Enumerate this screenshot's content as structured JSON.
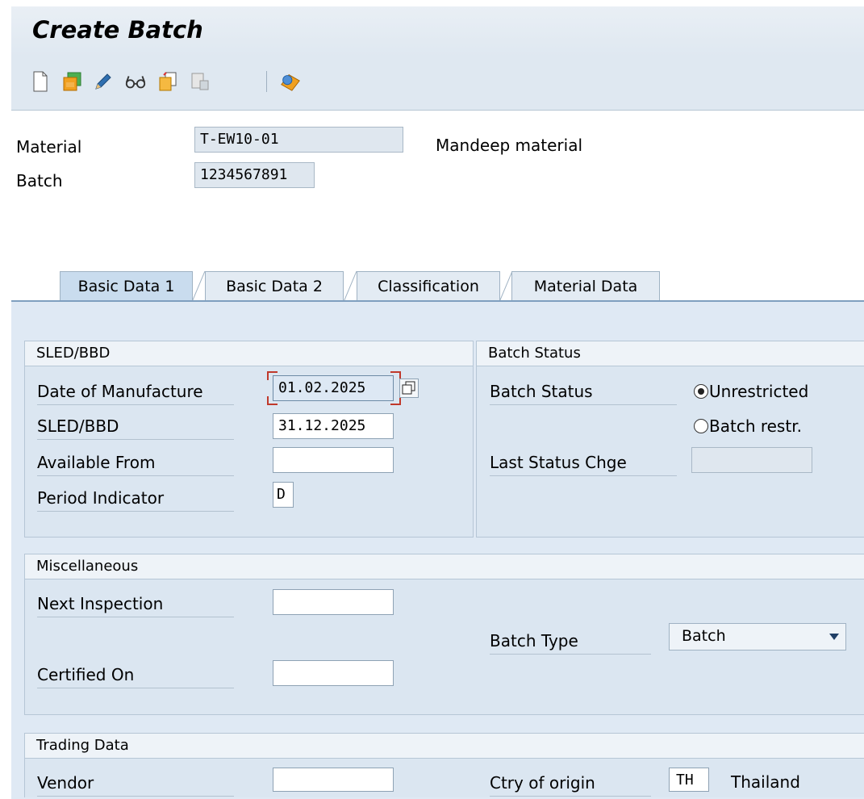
{
  "title": "Create Batch",
  "toolbar": {
    "icons": [
      "new-document-icon",
      "save-icon",
      "edit-pencil-icon",
      "display-glasses-icon",
      "copy-icon",
      "delete-icon",
      "where-used-icon"
    ]
  },
  "header": {
    "material_label": "Material",
    "material_value": "T-EW10-01",
    "material_desc": "Mandeep material",
    "batch_label": "Batch",
    "batch_value": "1234567891"
  },
  "tabs": [
    {
      "label": "Basic Data 1",
      "active": true
    },
    {
      "label": "Basic Data 2",
      "active": false
    },
    {
      "label": "Classification",
      "active": false
    },
    {
      "label": "Material Data",
      "active": false
    }
  ],
  "sled": {
    "title": "SLED/BBD",
    "date_of_manufacture_label": "Date of Manufacture",
    "date_of_manufacture_value": "01.02.2025",
    "sled_label": "SLED/BBD",
    "sled_value": "31.12.2025",
    "available_from_label": "Available From",
    "available_from_value": "",
    "period_indicator_label": "Period Indicator",
    "period_indicator_value": "D"
  },
  "batch_status": {
    "title": "Batch Status",
    "label": "Batch Status",
    "options": [
      {
        "label": "Unrestricted",
        "selected": true
      },
      {
        "label": "Batch restr.",
        "selected": false
      }
    ],
    "last_status_change_label": "Last Status Chge",
    "last_status_change_value": ""
  },
  "misc": {
    "title": "Miscellaneous",
    "next_inspection_label": "Next Inspection",
    "next_inspection_value": "",
    "batch_type_label": "Batch Type",
    "batch_type_value": "Batch",
    "certified_on_label": "Certified On",
    "certified_on_value": ""
  },
  "trading": {
    "title": "Trading Data",
    "vendor_label": "Vendor",
    "vendor_value": "",
    "country_label": "Ctry of origin",
    "country_code": "TH",
    "country_name": "Thailand"
  },
  "colors": {
    "panel": "#dfe9f4",
    "toolbar": "#dfe8f1",
    "focus": "#c0392b"
  }
}
